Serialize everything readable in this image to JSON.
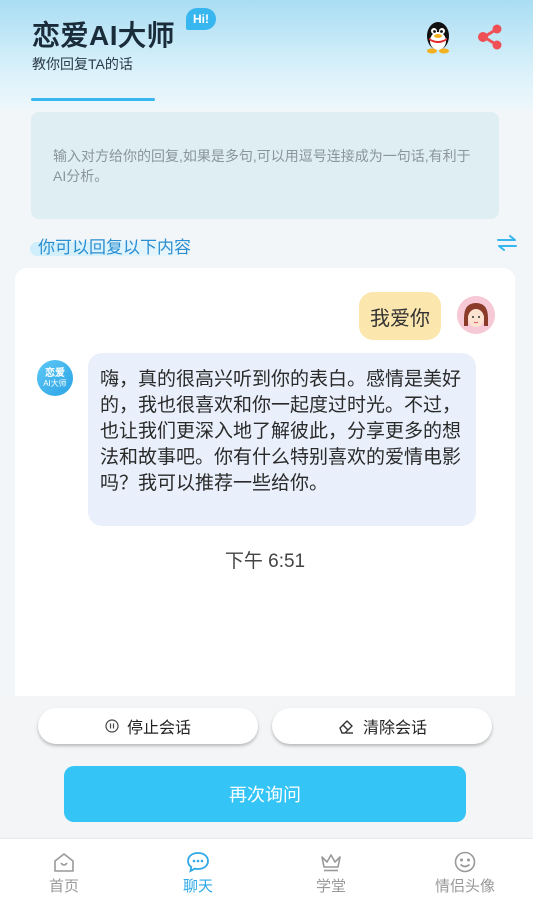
{
  "header": {
    "title": "恋爱AI大师",
    "badge": "Hi!",
    "subtitle": "教你回复TA的话"
  },
  "icons": {
    "qq": "qq-penguin-icon",
    "share": "share-icon",
    "swap": "swap-arrows-icon"
  },
  "input": {
    "placeholder": "输入对方给你的回复,如果是多句,可以用逗号连接成为一句话,有利于AI分析。",
    "value": ""
  },
  "reply_section": {
    "label": "你可以回复以下内容"
  },
  "chat": {
    "user_message": "我爱你",
    "bot_avatar_line1": "恋爱",
    "bot_avatar_line2": "AI大师",
    "bot_message": "嗨，真的很高兴听到你的表白。感情是美好的，我也很喜欢和你一起度过时光。不过，也让我们更深入地了解彼此，分享更多的想法和故事吧。你有什么特别喜欢的爱情电影吗？我可以推荐一些给你。",
    "timestamp": "下午 6:51"
  },
  "actions": {
    "stop_label": "停止会话",
    "clear_label": "清除会话",
    "ask_again_label": "再次询问"
  },
  "tabs": [
    {
      "label": "首页",
      "icon": "home-icon",
      "active": false
    },
    {
      "label": "聊天",
      "icon": "chat-icon",
      "active": true
    },
    {
      "label": "学堂",
      "icon": "crown-icon",
      "active": false
    },
    {
      "label": "情侣头像",
      "icon": "face-icon",
      "active": false
    }
  ],
  "colors": {
    "accent": "#34c4f6",
    "tab_active": "#2fa9e8",
    "user_bubble": "#fbe6ae",
    "bot_bubble": "#e9f0fb"
  }
}
